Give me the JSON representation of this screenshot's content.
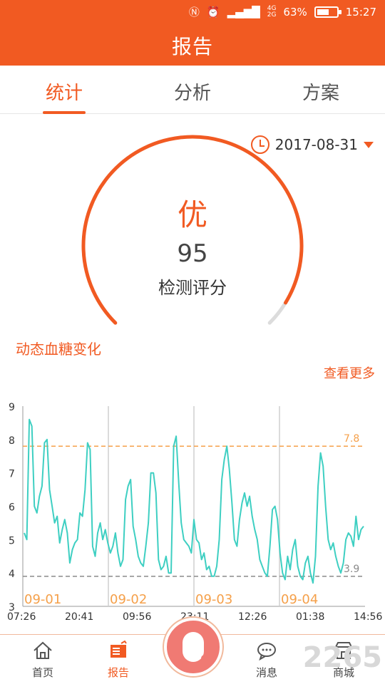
{
  "status_bar": {
    "battery_percent_text": "63%",
    "battery_level": 0.63,
    "time": "15:27",
    "icons": [
      "nfc-icon",
      "alarm-icon",
      "signal-icon",
      "network-4g-icon",
      "battery-icon"
    ]
  },
  "app_bar": {
    "title": "报告"
  },
  "tabs": [
    {
      "label": "统计",
      "active": true
    },
    {
      "label": "分析",
      "active": false
    },
    {
      "label": "方案",
      "active": false
    }
  ],
  "date_selector": {
    "value": "2017-08-31"
  },
  "score": {
    "grade": "优",
    "value": "95",
    "label": "检测评分",
    "level": 0.95
  },
  "section": {
    "title": "动态血糖变化",
    "more_link": "查看更多"
  },
  "chart_data": {
    "type": "line",
    "y_ticks": [
      "3",
      "4",
      "5",
      "6",
      "7",
      "8",
      "9"
    ],
    "ylim": [
      3,
      9
    ],
    "x_tick_labels": [
      "07:26",
      "20:41",
      "09:56",
      "23:11",
      "12:26",
      "01:38",
      "14:56"
    ],
    "day_labels": [
      "09-01",
      "09-02",
      "09-03",
      "09-04"
    ],
    "reference_lines": [
      {
        "value": 7.8,
        "label": "7.8",
        "color": "#f5a04a"
      },
      {
        "value": 3.9,
        "label": "3.9",
        "color": "#8a8a8a"
      }
    ],
    "series": [
      {
        "color": "#3ecfc2",
        "values": [
          5.2,
          5.0,
          8.6,
          8.4,
          6.0,
          5.8,
          6.3,
          6.6,
          7.9,
          8.0,
          6.5,
          6.0,
          5.5,
          5.7,
          4.9,
          5.3,
          5.6,
          5.2,
          4.3,
          4.7,
          4.9,
          5.0,
          5.8,
          5.7,
          6.5,
          7.9,
          7.7,
          4.8,
          4.5,
          5.2,
          5.5,
          5.0,
          5.3,
          4.9,
          4.6,
          4.8,
          5.2,
          4.6,
          4.2,
          4.4,
          6.2,
          6.6,
          6.8,
          5.4,
          5.0,
          4.5,
          4.3,
          4.2,
          4.8,
          5.5,
          7.0,
          7.0,
          6.4,
          4.4,
          4.1,
          4.2,
          4.5,
          4.0,
          4.0,
          7.8,
          8.1,
          6.7,
          5.5,
          5.0,
          4.9,
          4.8,
          4.6,
          5.6,
          5.0,
          4.9,
          4.4,
          4.6,
          4.1,
          4.2,
          3.9,
          3.9,
          4.2,
          5.0,
          6.8,
          7.4,
          7.8,
          7.1,
          6.1,
          5.0,
          4.8,
          5.6,
          6.1,
          6.4,
          6.0,
          6.3,
          5.7,
          5.3,
          5.0,
          4.4,
          4.2,
          4.0,
          3.9,
          4.8,
          5.9,
          6.0,
          5.6,
          4.6,
          4.0,
          3.8,
          4.5,
          4.1,
          4.7,
          5.0,
          4.2,
          3.9,
          3.8,
          4.3,
          4.5,
          4.0,
          3.7,
          4.5,
          6.6,
          7.6,
          7.2,
          6.0,
          5.0,
          4.7,
          4.9,
          4.5,
          4.2,
          4.0,
          4.3,
          5.0,
          5.2,
          5.1,
          4.8,
          5.7,
          5.0,
          5.3,
          5.4
        ]
      }
    ]
  },
  "bottom_nav": [
    {
      "label": "首页",
      "icon": "home-icon",
      "active": false
    },
    {
      "label": "报告",
      "icon": "report-icon",
      "active": true
    },
    {
      "label": "",
      "icon": "bluetooth-device-icon",
      "active": false
    },
    {
      "label": "消息",
      "icon": "message-icon",
      "active": false
    },
    {
      "label": "商城",
      "icon": "shop-icon",
      "active": false
    }
  ],
  "watermark": "2265"
}
